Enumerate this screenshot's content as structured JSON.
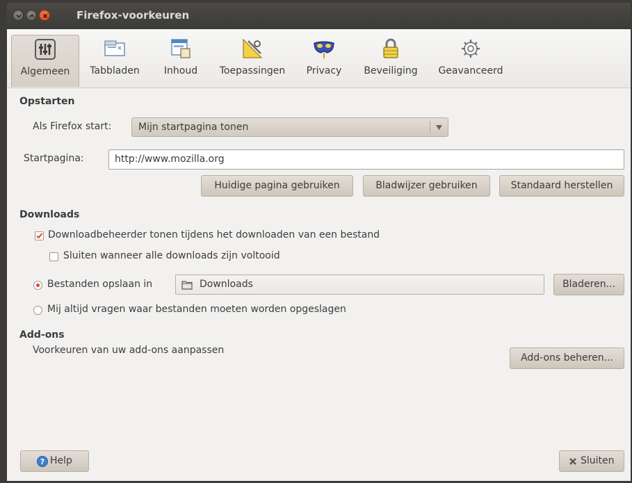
{
  "window": {
    "title": "Firefox-voorkeuren"
  },
  "tabs": [
    {
      "label": "Algemeen",
      "icon": "general-icon",
      "active": true
    },
    {
      "label": "Tabbladen",
      "icon": "tabs-icon"
    },
    {
      "label": "Inhoud",
      "icon": "content-icon"
    },
    {
      "label": "Toepassingen",
      "icon": "applications-icon"
    },
    {
      "label": "Privacy",
      "icon": "privacy-mask-icon"
    },
    {
      "label": "Beveiliging",
      "icon": "padlock-icon"
    },
    {
      "label": "Geavanceerd",
      "icon": "gear-icon"
    }
  ],
  "startup": {
    "heading": "Opstarten",
    "when_starts_label": "Als Firefox start:",
    "when_starts_value": "Mijn startpagina tonen",
    "homepage_label": "Startpagina:",
    "homepage_value": "http://www.mozilla.org",
    "use_current_button": "Huidige pagina gebruiken",
    "use_bookmark_button": "Bladwijzer gebruiken",
    "restore_default_button": "Standaard herstellen"
  },
  "downloads": {
    "heading": "Downloads",
    "show_manager_label": "Downloadbeheerder tonen tijdens het downloaden van een bestand",
    "show_manager_checked": true,
    "close_when_done_label": "Sluiten wanneer alle downloads zijn voltooid",
    "close_when_done_checked": false,
    "save_to_label": "Bestanden opslaan in",
    "save_to_selected": true,
    "folder_value": "Downloads",
    "browse_button": "Bladeren...",
    "always_ask_label": "Mij altijd vragen waar bestanden moeten worden opgeslagen",
    "always_ask_selected": false
  },
  "addons": {
    "heading": "Add-ons",
    "description": "Voorkeuren van uw add-ons aanpassen",
    "manage_button": "Add-ons beheren..."
  },
  "footer": {
    "help_button": "Help",
    "close_button": "Sluiten"
  },
  "colors": {
    "accent_check": "#e0452b",
    "titlebar": "#3c3b37"
  }
}
